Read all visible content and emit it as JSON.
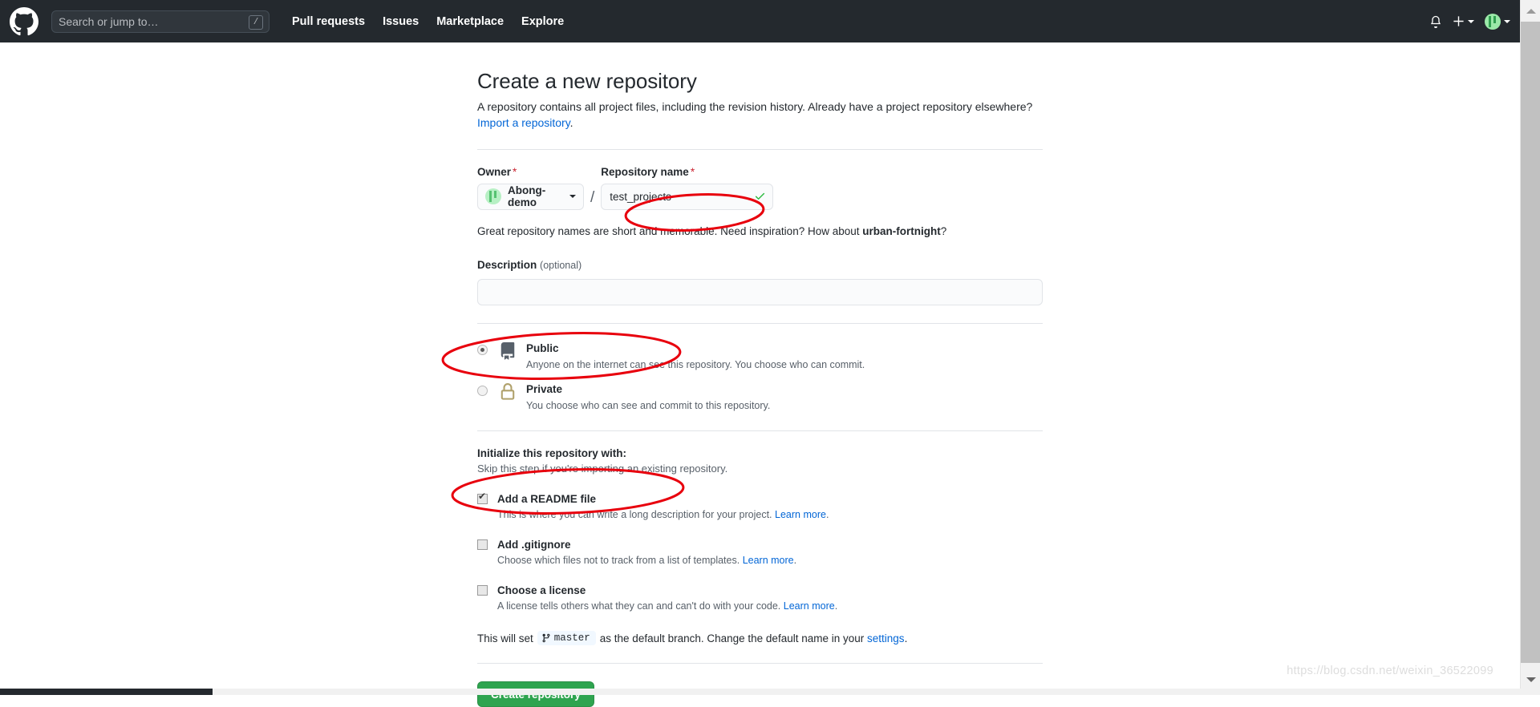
{
  "header": {
    "logo_icon": "github-mark-icon",
    "search": {
      "placeholder": "Search or jump to…",
      "shortcut_badge": "/"
    },
    "nav": [
      {
        "label": "Pull requests"
      },
      {
        "label": "Issues"
      },
      {
        "label": "Marketplace"
      },
      {
        "label": "Explore"
      }
    ],
    "right": {
      "notifications_icon": "bell-icon",
      "create_new_icon": "plus-icon",
      "create_new_caret_icon": "chevron-down-icon",
      "avatar_icon": "user-avatar",
      "avatar_caret_icon": "chevron-down-icon"
    },
    "background_color": "#24292e"
  },
  "page": {
    "title": "Create a new repository",
    "intro": "A repository contains all project files, including the revision history. Already have a project repository elsewhere?",
    "import_link": "Import a repository",
    "import_link_suffix": "."
  },
  "owner": {
    "label": "Owner",
    "required_marker": "*",
    "selected": "Abong-demo",
    "avatar_icon": "owner-avatar-icon",
    "caret_icon": "chevron-down-icon"
  },
  "repo_name": {
    "label": "Repository name",
    "required_marker": "*",
    "separator": "/",
    "value": "test_projects",
    "placeholder": "",
    "validation_icon": "check-icon",
    "validation_color": "#28a745"
  },
  "inspiration": {
    "prefix": "Great repository names are short and memorable. Need inspiration? How about ",
    "suggestion": "urban-fortnight",
    "suffix": "?"
  },
  "description": {
    "label": "Description",
    "optional_note": "(optional)",
    "value": "",
    "placeholder": ""
  },
  "visibility": {
    "options": [
      {
        "name": "Public",
        "description": "Anyone on the internet can see this repository. You choose who can commit.",
        "icon": "repo-book-icon",
        "icon_color": "#57606a",
        "selected": true
      },
      {
        "name": "Private",
        "description": "You choose who can see and commit to this repository.",
        "icon": "lock-icon",
        "icon_color": "#b0a16b",
        "selected": false
      }
    ]
  },
  "initialize": {
    "title": "Initialize this repository with:",
    "subtitle": "Skip this step if you're importing an existing repository.",
    "options": [
      {
        "name": "Add a README file",
        "description": "This is where you can write a long description for your project.",
        "learn_more": "Learn more",
        "learn_more_suffix": ".",
        "checked": true
      },
      {
        "name": "Add .gitignore",
        "description": "Choose which files not to track from a list of templates.",
        "learn_more": "Learn more",
        "learn_more_suffix": ".",
        "checked": false
      },
      {
        "name": "Choose a license",
        "description": "A license tells others what they can and can't do with your code.",
        "learn_more": "Learn more",
        "learn_more_suffix": ".",
        "checked": false
      }
    ]
  },
  "branch_note": {
    "prefix": "This will set",
    "branch_icon": "git-branch-icon",
    "branch_name": "master",
    "middle": "as the default branch. Change the default name in your",
    "settings_link": "settings",
    "suffix": "."
  },
  "submit": {
    "label": "Create repository",
    "color": "#2ea44f"
  },
  "annotations": {
    "tool": "red-ellipse-markup",
    "color": "#e8000d",
    "marks": [
      {
        "target": "repo-name-input"
      },
      {
        "target": "visibility-option-public"
      },
      {
        "target": "init-option-readme"
      }
    ]
  },
  "watermark": {
    "text": "https://blog.csdn.net/weixin_36522099"
  }
}
